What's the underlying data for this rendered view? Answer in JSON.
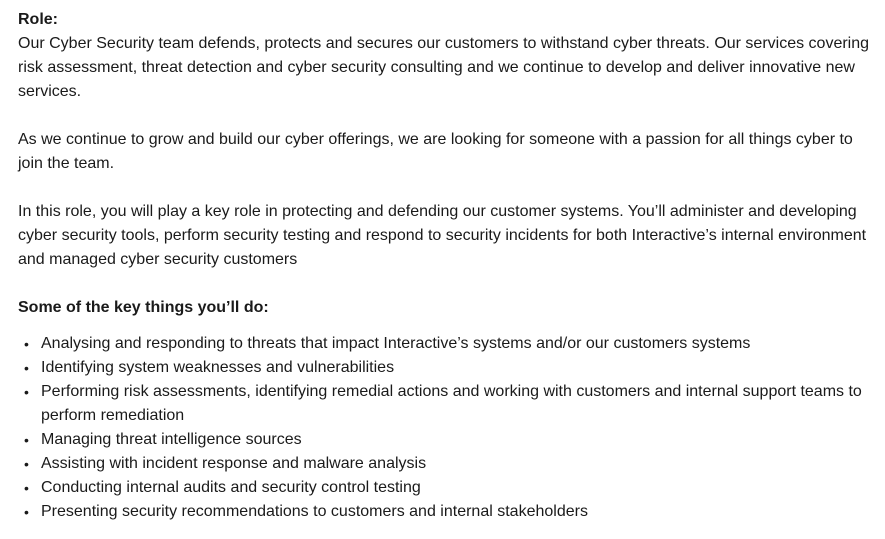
{
  "role_heading": "Role:",
  "paragraphs": [
    "Our Cyber Security team defends, protects and secures our customers to withstand cyber threats. Our services covering risk assessment, threat detection and cyber security consulting and we continue to develop and deliver innovative new services.",
    "As we continue to grow and build our cyber offerings, we are looking for someone with a passion for all things cyber to join the team.",
    "In this role, you will play a key role in protecting and defending our customer systems. You’ll administer and developing cyber security tools, perform security testing and respond to security incidents for both Interactive’s internal environment and managed cyber security customers"
  ],
  "key_things_heading": "Some of the key things you’ll do:",
  "bullet_glyph": "•",
  "key_things": [
    "Analysing and responding to threats that impact Interactive’s systems and/or our customers systems",
    "Identifying system weaknesses and vulnerabilities",
    "Performing risk assessments, identifying remedial actions and working with customers and internal support teams to perform remediation",
    "Managing threat intelligence sources",
    "Assisting with incident response and malware analysis",
    "Conducting internal audits and security control testing",
    "Presenting security recommendations to customers and internal stakeholders"
  ]
}
